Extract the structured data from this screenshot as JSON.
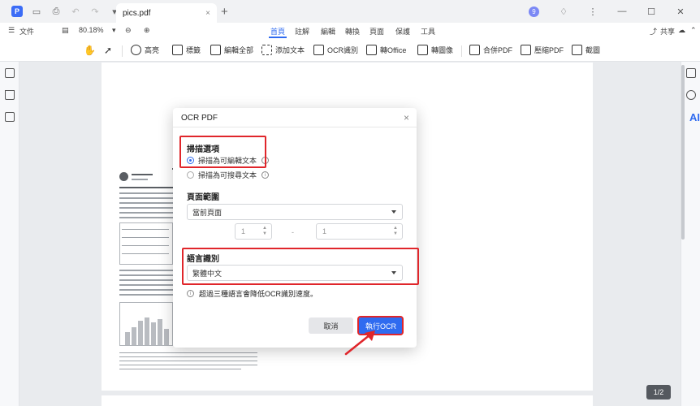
{
  "titlebar": {
    "tab_title": "pics.pdf",
    "tab_close": "×",
    "new_tab": "+",
    "badge_count": "9"
  },
  "menubar": {
    "file": "文件",
    "zoom": "80.18%",
    "tabs": [
      "首頁",
      "註解",
      "編輯",
      "轉換",
      "頁面",
      "保護",
      "工具"
    ],
    "share": "共享"
  },
  "toolbar": {
    "highlight": "高亮",
    "mark": "標籤",
    "edit_all": "編輯全部",
    "add_text": "添加文本",
    "ocr": "OCR識別",
    "to_office": "轉Office",
    "to_image": "轉圖像",
    "merge_pdf": "合併PDF",
    "compress_pdf": "壓縮PDF",
    "screenshot": "截圖"
  },
  "sidebar_right": {
    "ai_label": "AI"
  },
  "dialog": {
    "title": "OCR PDF",
    "close": "×",
    "scan_options_label": "掃描選項",
    "scan_option_editable": "掃描為可編輯文本",
    "scan_option_searchable": "掃描為可搜尋文本",
    "page_range_label": "頁面範圍",
    "page_range_value": "當前頁面",
    "range_from": "1",
    "range_to": "1",
    "range_sep": "-",
    "language_label": "語言識別",
    "language_value": "繁體中文",
    "hint": "超過三種語言會降低OCR識別速度。",
    "cancel": "取消",
    "run": "執行OCR"
  },
  "page_counter": "1/2",
  "colors": {
    "accent": "#2f6bf0",
    "highlight_box": "#e0262b",
    "arrow": "#e0262b"
  }
}
